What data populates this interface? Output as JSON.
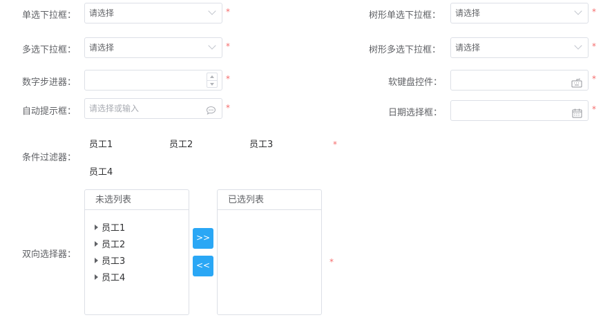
{
  "fields": {
    "single_select": {
      "label": "单选下拉框：",
      "placeholder": "请选择"
    },
    "tree_single_select": {
      "label": "树形单选下拉框：",
      "placeholder": "请选择"
    },
    "multi_select": {
      "label": "多选下拉框：",
      "placeholder": "请选择"
    },
    "tree_multi_select": {
      "label": "树形多选下拉框：",
      "placeholder": "请选择"
    },
    "number_stepper": {
      "label": "数字步进器：",
      "value": ""
    },
    "soft_keyboard": {
      "label": "软键盘控件：",
      "value": ""
    },
    "autocomplete": {
      "label": "自动提示框：",
      "placeholder": "请选择或输入"
    },
    "date_picker": {
      "label": "日期选择框：",
      "value": ""
    },
    "condition_filter": {
      "label": "条件过滤器：",
      "options": [
        "员工1",
        "员工2",
        "员工3",
        "员工4"
      ]
    },
    "transfer": {
      "label": "双向选择器：",
      "left_title": "未选列表",
      "right_title": "已选列表",
      "left_items": [
        "员工1",
        "员工2",
        "员工3",
        "员工4"
      ],
      "right_items": [],
      "to_right_label": ">>",
      "to_left_label": "<<"
    }
  },
  "required_mark": "*",
  "colors": {
    "required": "#f56c6c",
    "primary_button": "#2aa7f5",
    "border": "#dcdfe6",
    "label": "#606266"
  },
  "icons": {
    "select_arrow": "chevron-down-icon",
    "autocomplete": "comment-icon",
    "keyboard": "keyboard-icon",
    "calendar": "calendar-icon",
    "tree_node": "caret-right-icon"
  }
}
